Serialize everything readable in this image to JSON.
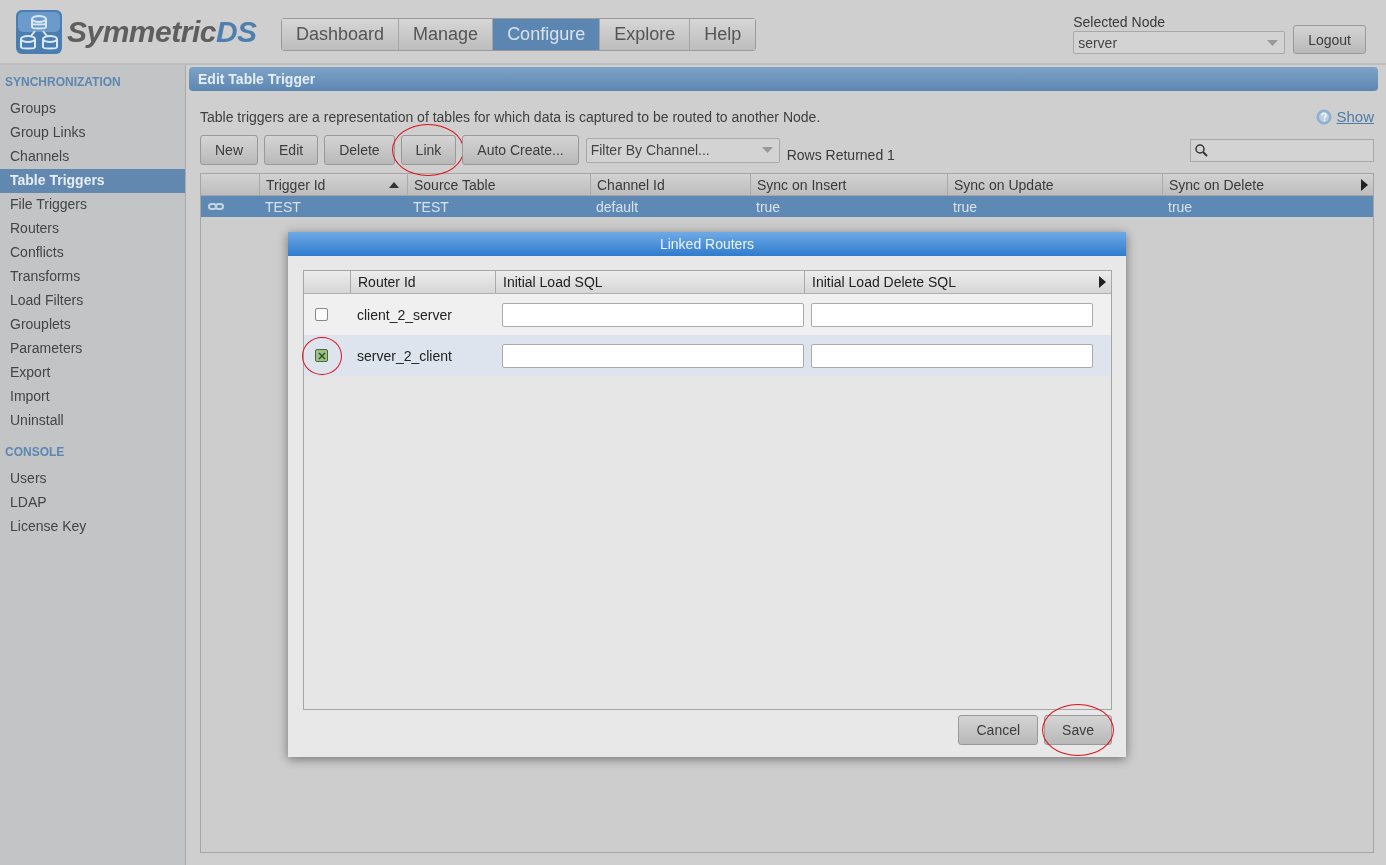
{
  "logo": {
    "name": "Symmetric",
    "suffix": "DS"
  },
  "nav": [
    {
      "label": "Dashboard",
      "selected": false
    },
    {
      "label": "Manage",
      "selected": false
    },
    {
      "label": "Configure",
      "selected": true
    },
    {
      "label": "Explore",
      "selected": false
    },
    {
      "label": "Help",
      "selected": false
    }
  ],
  "node_selector": {
    "label": "Selected Node",
    "value": "server"
  },
  "logout": "Logout",
  "sidebar": [
    {
      "title": "SYNCHRONIZATION",
      "items": [
        {
          "label": "Groups",
          "selected": false
        },
        {
          "label": "Group Links",
          "selected": false
        },
        {
          "label": "Channels",
          "selected": false
        },
        {
          "label": "Table Triggers",
          "selected": true
        },
        {
          "label": "File Triggers",
          "selected": false
        },
        {
          "label": "Routers",
          "selected": false
        },
        {
          "label": "Conflicts",
          "selected": false
        },
        {
          "label": "Transforms",
          "selected": false
        },
        {
          "label": "Load Filters",
          "selected": false
        },
        {
          "label": "Grouplets",
          "selected": false
        },
        {
          "label": "Parameters",
          "selected": false
        },
        {
          "label": "Export",
          "selected": false
        },
        {
          "label": "Import",
          "selected": false
        },
        {
          "label": "Uninstall",
          "selected": false
        }
      ]
    },
    {
      "title": "CONSOLE",
      "items": [
        {
          "label": "Users",
          "selected": false
        },
        {
          "label": "LDAP",
          "selected": false
        },
        {
          "label": "License Key",
          "selected": false
        }
      ]
    }
  ],
  "panel": {
    "title": "Edit Table Trigger",
    "description": "Table triggers are a representation of tables for which data is captured to be routed to another Node.",
    "help_link": "Show",
    "toolbar": [
      {
        "label": "New",
        "annotated": false
      },
      {
        "label": "Edit",
        "annotated": false
      },
      {
        "label": "Delete",
        "annotated": false
      },
      {
        "label": "Link",
        "annotated": true
      },
      {
        "label": "Auto Create...",
        "annotated": false
      }
    ],
    "filter": {
      "label": "Filter By Channel..."
    },
    "rows_returned": "Rows Returned 1",
    "table": {
      "columns": [
        {
          "label": "Trigger Id",
          "sorted": true
        },
        {
          "label": "Source Table",
          "sorted": false
        },
        {
          "label": "Channel Id",
          "sorted": false
        },
        {
          "label": "Sync on Insert",
          "sorted": false
        },
        {
          "label": "Sync on Update",
          "sorted": false
        },
        {
          "label": "Sync on Delete",
          "sorted": false
        }
      ],
      "rows": [
        {
          "selected": true,
          "cells": [
            "TEST",
            "TEST",
            "default",
            "true",
            "true",
            "true"
          ]
        }
      ]
    }
  },
  "dialog": {
    "title": "Linked Routers",
    "columns": [
      "Router Id",
      "Initial Load SQL",
      "Initial Load Delete SQL"
    ],
    "rows": [
      {
        "router_id": "client_2_server",
        "checked": false,
        "selected": false,
        "annotated": false
      },
      {
        "router_id": "server_2_client",
        "checked": true,
        "selected": true,
        "annotated": true
      }
    ],
    "buttons": [
      {
        "label": "Cancel",
        "annotated": false
      },
      {
        "label": "Save",
        "annotated": true
      }
    ]
  }
}
